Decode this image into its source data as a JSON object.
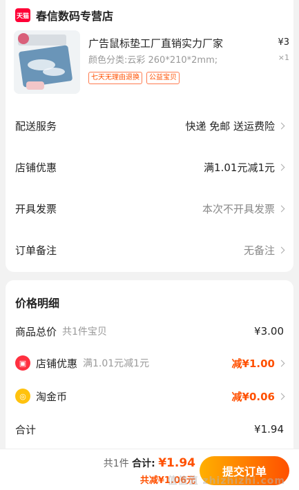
{
  "store": {
    "badge": "天猫",
    "name": "春信数码专营店"
  },
  "product": {
    "title": "广告鼠标垫工厂直销实力厂家",
    "price": "¥3",
    "spec": "颜色分类:云彩 260*210*2mm;",
    "qty": "×1",
    "tags": [
      "七天无理由退换",
      "公益宝贝"
    ]
  },
  "order": {
    "delivery_label": "配送服务",
    "delivery_value": "快递 免邮 送运费险",
    "discount_label": "店铺优惠",
    "discount_value": "满1.01元减1元",
    "invoice_label": "开具发票",
    "invoice_value": "本次不开具发票",
    "note_label": "订单备注",
    "note_value": "无备注"
  },
  "price_detail": {
    "title": "价格明细",
    "goods_label": "商品总价",
    "goods_sub": "共1件宝贝",
    "goods_value": "¥3.00",
    "shop_discount_label": "店铺优惠",
    "shop_discount_sub": "满1.01元减1元",
    "shop_discount_value": "减¥1.00",
    "coin_label": "淘金币",
    "coin_value": "减¥0.06",
    "total_label": "合计",
    "total_value": "¥1.94"
  },
  "bottom": {
    "count": "共1件",
    "total_label": "合计:",
    "total_value": "¥1.94",
    "saved": "共减¥1.06元",
    "submit": "提交订单"
  },
  "watermark": "值值值 zhizhizhi.com",
  "colors": {
    "accent": "#ff5000",
    "tmall": "#ff0036"
  }
}
